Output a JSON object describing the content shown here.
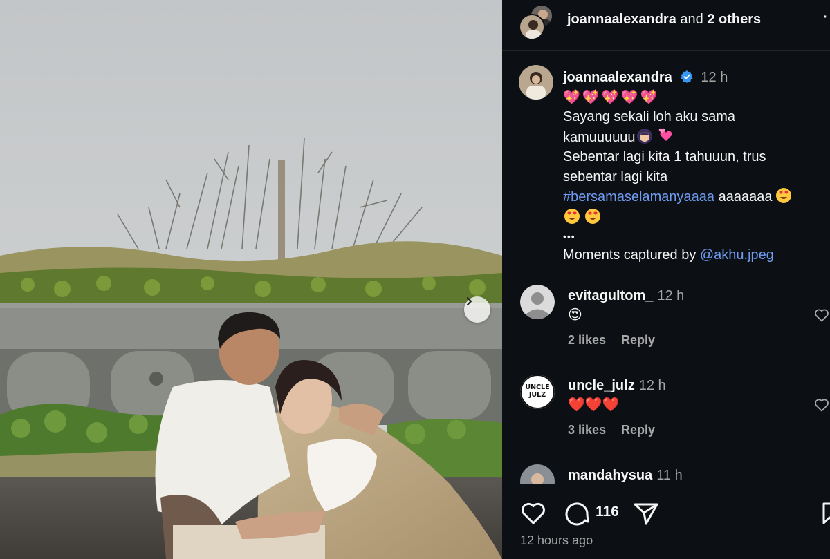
{
  "header": {
    "username": "joannaalexandra",
    "connector": " and ",
    "others": "2 others",
    "more_icon": "more-icon"
  },
  "caption": {
    "username": "joannaalexandra",
    "verified": true,
    "time": "12 h",
    "emoji_line": "💖💖💖💖💖",
    "line1": "Sayang sekali loh aku sama",
    "line2": "kamuuuuuu",
    "line3": "Sebentar lagi kita 1 tahuuun, trus",
    "line4": "sebentar lagi kita",
    "hashtag": "#bersamaselamanyaaaa",
    "hashtag_tail": " aaaaaaa",
    "ellipsis": "•••",
    "credit_prefix": "Moments captured by ",
    "credit_mention": "@akhu.jpeg"
  },
  "comments": [
    {
      "username": "evitagultom_",
      "time": "12 h",
      "text": "😍",
      "likes": "2 likes",
      "reply": "Reply",
      "avatar": "default-avatar"
    },
    {
      "username": "uncle_julz",
      "time": "12 h",
      "text": "❤️❤️❤️",
      "likes": "3 likes",
      "reply": "Reply",
      "avatar": "uncle-julz-logo",
      "avatar_text": "UNCLE JULZ"
    },
    {
      "username": "mandahysua",
      "time": "11 h"
    }
  ],
  "footer": {
    "comment_count": "116",
    "posted": "12 hours ago"
  },
  "colors": {
    "background": "#0c1014",
    "link": "#6f9cf2",
    "secondary_text": "#a8a8a8",
    "verified": "#3897f0"
  }
}
